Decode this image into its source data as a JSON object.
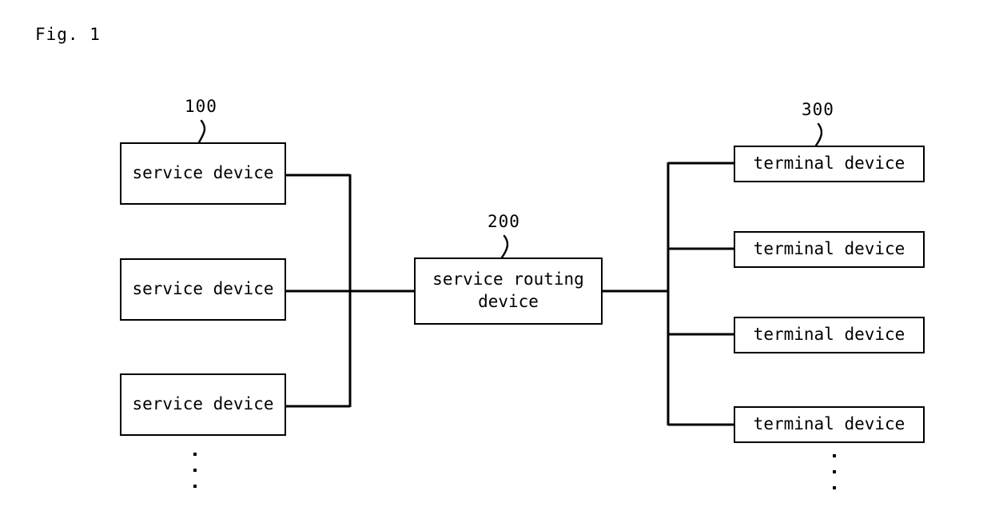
{
  "figure": {
    "caption": "Fig. 1"
  },
  "groups": {
    "service": {
      "ref_number": "100",
      "nodes": [
        {
          "label": "service device"
        },
        {
          "label": "service device"
        },
        {
          "label": "service device"
        }
      ],
      "continuation": "vertical-ellipsis"
    },
    "router": {
      "ref_number": "200",
      "label": "service routing\ndevice"
    },
    "terminal": {
      "ref_number": "300",
      "nodes": [
        {
          "label": "terminal device"
        },
        {
          "label": "terminal device"
        },
        {
          "label": "terminal device"
        },
        {
          "label": "terminal device"
        }
      ],
      "continuation": "vertical-ellipsis"
    }
  },
  "style": {
    "ink": "#000000",
    "paper": "#ffffff"
  }
}
